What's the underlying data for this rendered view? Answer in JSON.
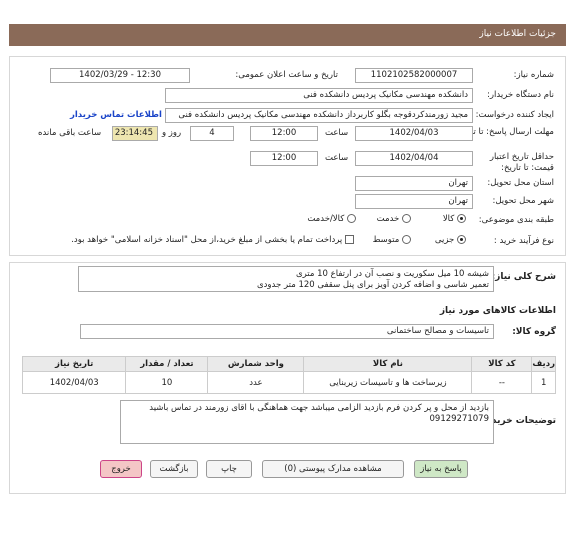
{
  "header": {
    "title": "جزئیات اطلاعات نیاز"
  },
  "fields": {
    "need_number_label": "شماره نیاز:",
    "need_number": "1102102582000007",
    "announce_label": "تاریخ و ساعت اعلان عمومی:",
    "announce_value": "1402/03/29 - 12:30",
    "buyer_label": "نام دستگاه خریدار:",
    "buyer_value": "دانشکده مهندسی مکانیک پردیس دانشکده فنی",
    "creator_label": "ایجاد کننده درخواست:",
    "creator_value": "مجید زورمندکردقوجه بگلو کاربرداز دانشکده مهندسی مکانیک پردیس دانشکده فنی",
    "contact_link": "اطلاعات تماس خریدار",
    "deadline_label": "مهلت ارسال پاسخ: تا تاریخ:",
    "deadline_date": "1402/04/03",
    "time_label": "ساعت",
    "deadline_time": "12:00",
    "days_value": "4",
    "days_label": "روز و",
    "remaining_time": "23:14:45",
    "remaining_label": "ساعت باقی مانده",
    "min_price_label": "حداقل تاریخ اعتبار قیمت: تا تاریخ:",
    "min_price_date": "1402/04/04",
    "min_price_time": "12:00",
    "province_label": "استان محل تحویل:",
    "province_value": "تهران",
    "city_label": "شهر محل تحویل:",
    "city_value": "تهران",
    "category_label": "طبقه بندی موضوعی:",
    "category_options": [
      "کالا",
      "خدمت",
      "کالا/خدمت"
    ],
    "process_label": "نوع فرآیند خرید :",
    "process_options": [
      "جزیی",
      "متوسط"
    ],
    "payment_note": "پرداخت تمام یا بخشی از مبلغ خرید،از محل \"اسناد خزانه اسلامی\" خواهد بود."
  },
  "description": {
    "label": "شرح کلی نیاز:",
    "line1": "شیشه 10 میل سکوریت و نصب آن در ارتفاع 10 متری",
    "line2": "تعمیر شاسی و اضافه کردن آویز برای پنل سقفی 120 متر جدودی"
  },
  "goods": {
    "section_title": "اطلاعات کالاهای مورد نیاز",
    "group_label": "گروه کالا:",
    "group_value": "تاسیسات و مصالح ساختمانی",
    "columns": [
      "ردیف",
      "کد کالا",
      "نام کالا",
      "واحد شمارش",
      "تعداد / مقدار",
      "تاریخ نیاز"
    ],
    "rows": [
      [
        "1",
        "--",
        "زیرساخت ها و تاسیسات زیربنایی",
        "عدد",
        "10",
        "1402/04/03"
      ]
    ]
  },
  "buyer_notes": {
    "label": "توضیحات خریدار:",
    "line1": "بازدید از محل و پر کردن فرم بازدید الزامی میباشد جهت هماهنگی با اقای زورمند در تماس باشید",
    "line2": "09129271079"
  },
  "buttons": {
    "reply": "پاسخ به نیاز",
    "docs": "مشاهده مدارک پیوستی (0)",
    "print": "چاپ",
    "back": "بازگشت",
    "exit": "خروج"
  },
  "colors": {
    "title_bar": "#8a6a58",
    "timer_bg": "#eee6b0",
    "exit_bg": "#f4c6c6",
    "reply_bg": "#cfe8c6"
  }
}
